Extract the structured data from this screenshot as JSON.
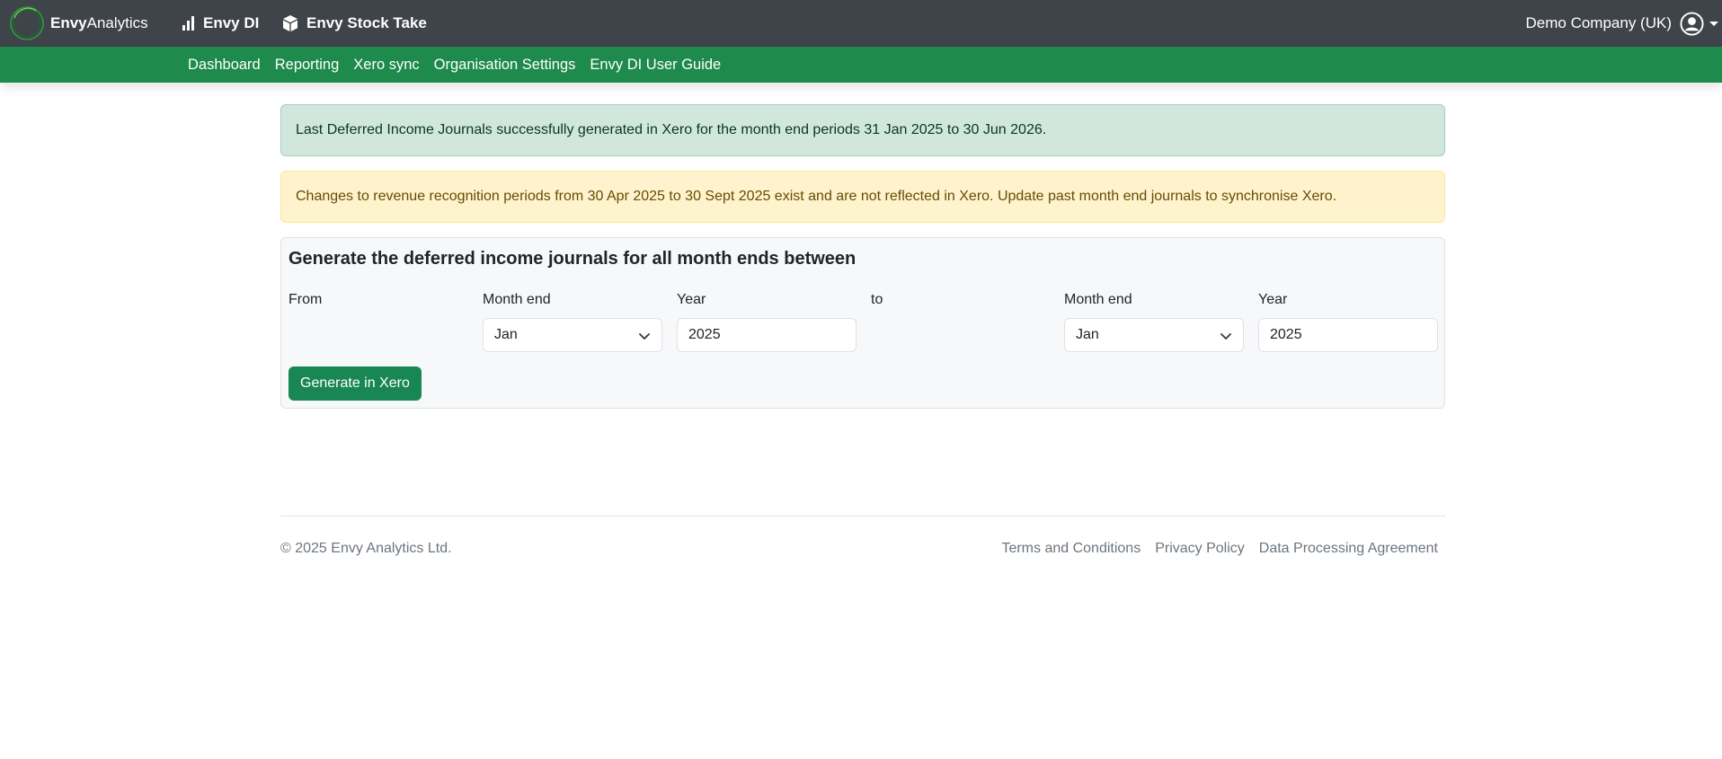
{
  "brand": {
    "name_bold": "Envy",
    "name_rest": "Analytics",
    "logo_icon": "circle-logo-icon",
    "accent": "#1e8a4c"
  },
  "topnav": {
    "items": [
      {
        "label": "Envy DI",
        "icon": "bar-chart-icon"
      },
      {
        "label": "Envy Stock Take",
        "icon": "box-icon"
      }
    ],
    "company": "Demo Company (UK)",
    "user_icon": "user-circle-icon"
  },
  "subnav": {
    "items": [
      {
        "label": "Dashboard"
      },
      {
        "label": "Reporting"
      },
      {
        "label": "Xero sync"
      },
      {
        "label": "Organisation Settings"
      },
      {
        "label": "Envy DI User Guide"
      }
    ]
  },
  "alerts": {
    "success": "Last Deferred Income Journals successfully generated in Xero for the month end periods 31 Jan 2025 to 30 Jun 2026.",
    "warning": "Changes to revenue recognition periods from 30 Apr 2025 to 30 Sept 2025 exist and are not reflected in Xero. Update past month end journals to synchronise Xero."
  },
  "generate_form": {
    "title": "Generate the deferred income journals for all month ends between",
    "from_label": "From",
    "to_label": "to",
    "from": {
      "month_label": "Month end",
      "month_value": "Jan",
      "year_label": "Year",
      "year_value": "2025"
    },
    "to": {
      "month_label": "Month end",
      "month_value": "Jan",
      "year_label": "Year",
      "year_value": "2025"
    },
    "button_label": "Generate in Xero"
  },
  "footer": {
    "copyright": "© 2025 Envy Analytics Ltd.",
    "links": [
      {
        "label": "Terms and Conditions"
      },
      {
        "label": "Privacy Policy"
      },
      {
        "label": "Data Processing Agreement"
      }
    ]
  }
}
